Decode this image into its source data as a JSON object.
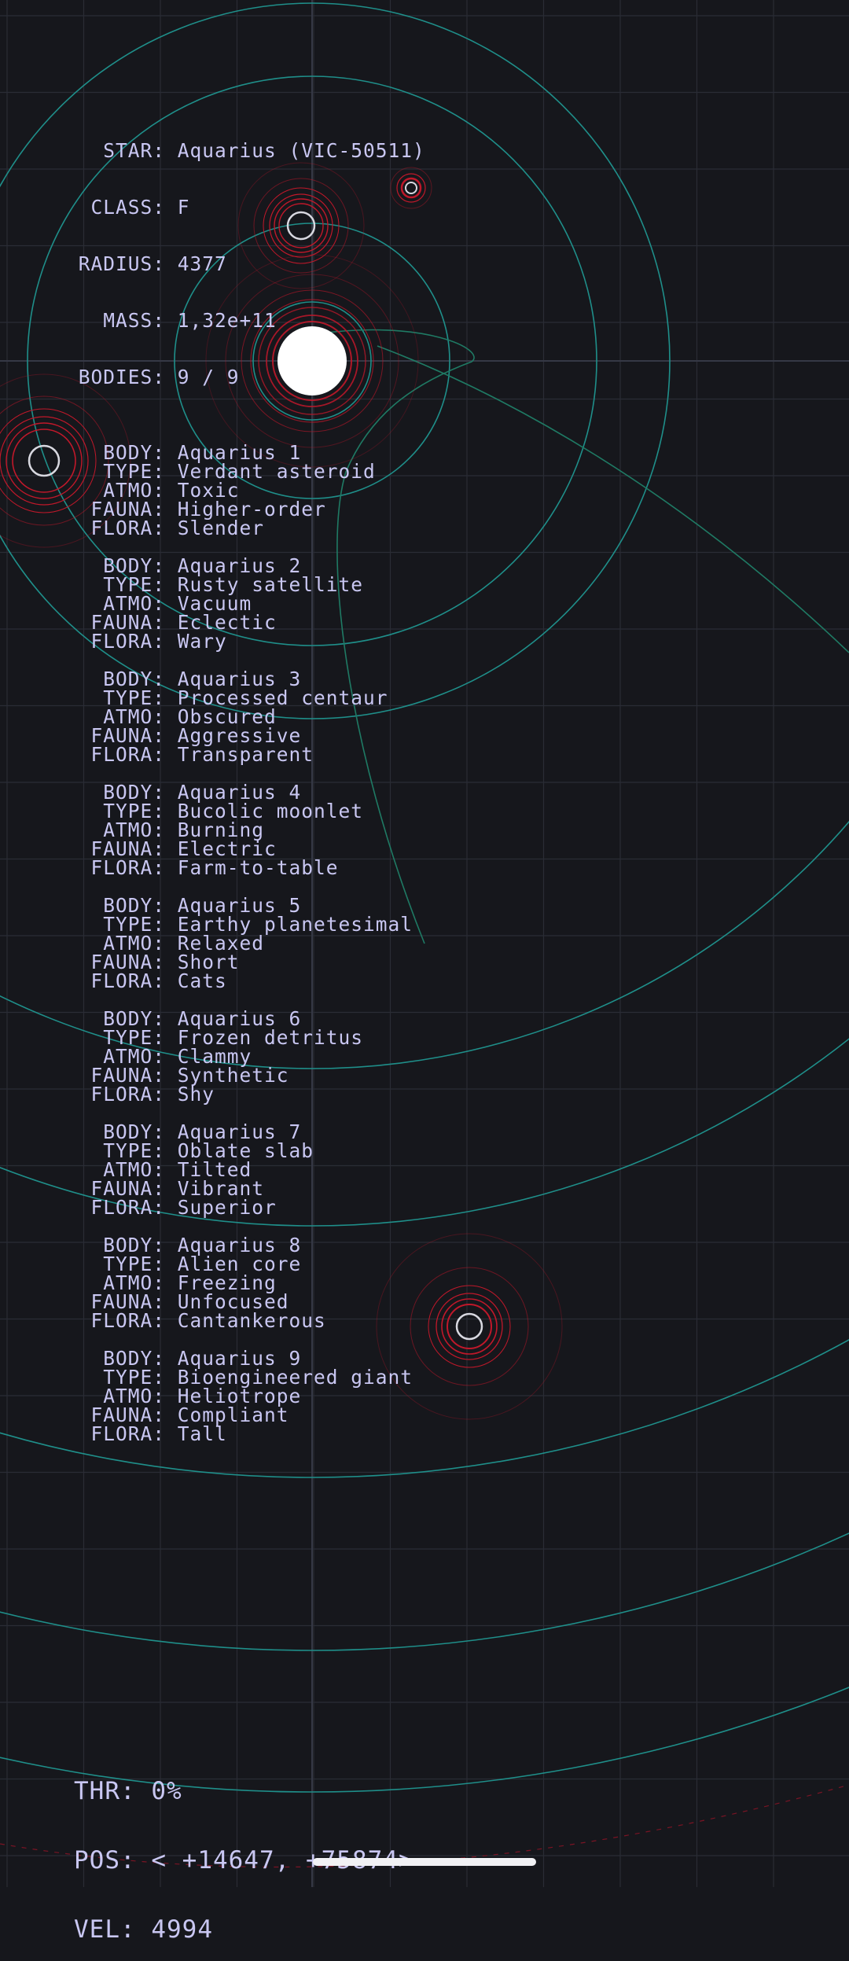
{
  "star": {
    "label_star": "STAR:",
    "name": "Aquarius (VIC-50511)",
    "label_class": "CLASS:",
    "class": "F",
    "label_radius": "RADIUS:",
    "radius": "4377",
    "label_mass": "MASS:",
    "mass": "1,32e+11",
    "label_bodies": "BODIES:",
    "bodies": "9 / 9"
  },
  "body_labels": {
    "body": "BODY:",
    "type": "TYPE:",
    "atmo": "ATMO:",
    "fauna": "FAUNA:",
    "flora": "FLORA:"
  },
  "bodies": [
    {
      "name": "Aquarius 1",
      "type": "Verdant asteroid",
      "atmo": "Toxic",
      "fauna": "Higher-order",
      "flora": "Slender"
    },
    {
      "name": "Aquarius 2",
      "type": "Rusty satellite",
      "atmo": "Vacuum",
      "fauna": "Eclectic",
      "flora": "Wary"
    },
    {
      "name": "Aquarius 3",
      "type": "Processed centaur",
      "atmo": "Obscured",
      "fauna": "Aggressive",
      "flora": "Transparent"
    },
    {
      "name": "Aquarius 4",
      "type": "Bucolic moonlet",
      "atmo": "Burning",
      "fauna": "Electric",
      "flora": "Farm-to-table"
    },
    {
      "name": "Aquarius 5",
      "type": "Earthy planetesimal",
      "atmo": "Relaxed",
      "fauna": "Short",
      "flora": "Cats"
    },
    {
      "name": "Aquarius 6",
      "type": "Frozen detritus",
      "atmo": "Clammy",
      "fauna": "Synthetic",
      "flora": "Shy"
    },
    {
      "name": "Aquarius 7",
      "type": "Oblate slab",
      "atmo": "Tilted",
      "fauna": "Vibrant",
      "flora": "Superior"
    },
    {
      "name": "Aquarius 8",
      "type": "Alien core",
      "atmo": "Freezing",
      "fauna": "Unfocused",
      "flora": "Cantankerous"
    },
    {
      "name": "Aquarius 9",
      "type": "Bioengineered giant",
      "atmo": "Heliotrope",
      "fauna": "Compliant",
      "flora": "Tall"
    }
  ],
  "hud": {
    "label_thr": "THR:",
    "thr": "0%",
    "label_pos": "POS:",
    "pos": "< +14647, +75874>",
    "label_vel": "VEL:",
    "vel": "4994"
  },
  "colors": {
    "background": "#16171c",
    "grid": "#2a2c35",
    "orbit": "#1f8f8a",
    "planet_ring": "#c0182a",
    "text": "#c9c7f2",
    "star": "#ffffff"
  }
}
